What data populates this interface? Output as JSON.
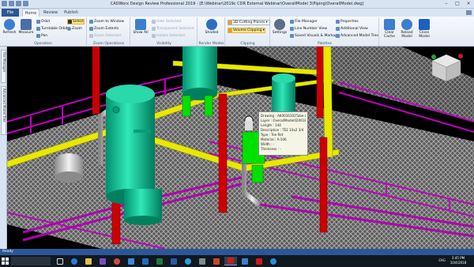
{
  "titlebar": {
    "title": "CADWorx Design Review Professional 2019 - [E:\\Webinar\\2019c CDR External Webinar\\OverallModel 3\\Piping\\OverallModel.dwg]"
  },
  "tabs": {
    "file": "File",
    "home": "Home",
    "review": "Review",
    "publish": "Publish"
  },
  "ribbon": {
    "refresh": "Refresh",
    "measure": "Measure",
    "orbit": "Orbit",
    "turntable_orbit": "Turntable Orbit",
    "pan": "Pan",
    "select": "Select",
    "zoom": "Zoom",
    "operation_group": "Operation",
    "zoom_to_window": "Zoom to Window",
    "zoom_extents": "Zoom Extents",
    "zoom_selected": "Zoom Selected",
    "zoom_group": "Zoom Operations",
    "show_all": "Show All",
    "hide_selected": "Hide Selected",
    "transparent_selected": "Transparent Selected",
    "isolate_selected": "Isolate Selected",
    "visibility_group": "Visibility",
    "shaded": "Shaded",
    "render_group": "Render Modes",
    "cutting_planes": "3D Cutting Planes",
    "volume_clipping": "Volume Clipping",
    "clipping_group": "Clipping",
    "settings": "Settings",
    "file_manager": "File Manager",
    "line_number_view": "Line Number View",
    "saved_visuals": "Saved Visuals & Markup",
    "properties": "Properties",
    "additional_view": "Additional View",
    "advanced_model_tree": "Advanced Model Tree",
    "palettes_group": "Palettes",
    "clear_cache": "Clear Cache",
    "reload_model": "Reload Model",
    "close_model": "Close Model"
  },
  "sidebar": {
    "tab1": "File Manager",
    "tab2": "Advanced Model Tree"
  },
  "tooltip": {
    "lines": [
      "Drawing : AK0016102Tube.dwg",
      "Layer : OverallModel0206181222001",
      "Length : 144",
      "Description : TEE 10x2 3/4",
      "Type : Tee Ret",
      "Material : A-106",
      "Width : -",
      "Thickness : -"
    ]
  },
  "statusbar": {
    "text": "Ready"
  },
  "taskbar": {
    "search_placeholder": "",
    "tray": "ENG",
    "time": "2:45 PM",
    "date": "10/4/2018"
  },
  "colors": {
    "structure_red": "#cc0000",
    "beam_yellow": "#e8e800",
    "pipe_magenta": "#c000c0",
    "vessel_teal": "#00c89a",
    "grating_gray": "#8a8a8a"
  }
}
